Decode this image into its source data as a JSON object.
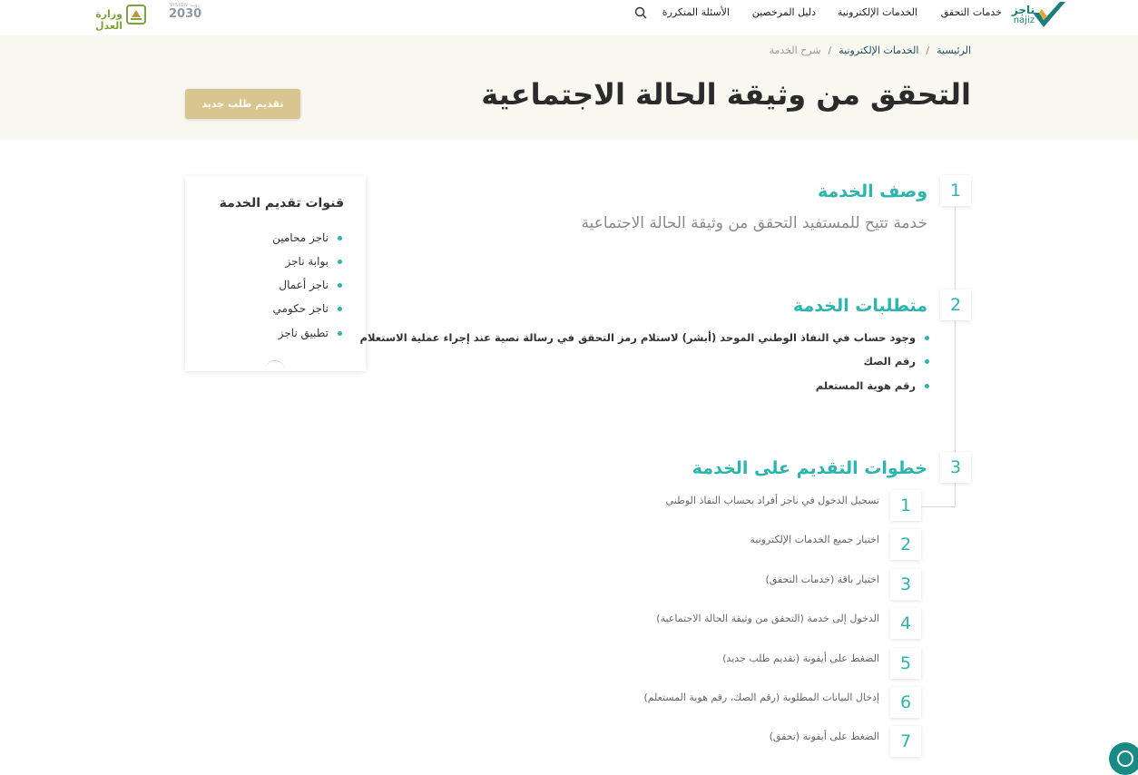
{
  "nav": {
    "brand_ar": "ناجز",
    "brand_en": "najiz",
    "items": [
      "خدمات التحقق",
      "الخدمات الإلكترونية",
      "دليل المرخصين",
      "الأسئلة المتكررة"
    ],
    "vision_top": "VISION رؤيـة",
    "vision_num": "2030",
    "moj": "وزارة العدل"
  },
  "breadcrumb": {
    "home": "الرئيسية",
    "sep": "/",
    "eservices": "الخدمات الإلكترونية",
    "current": "شرح الخدمة"
  },
  "page": {
    "title": "التحقق من وثيقة الحالة الاجتماعية",
    "new_request_button": "تقديم طلب جديد"
  },
  "channels": {
    "title": "قنوات تقديم الخدمة",
    "items": [
      "ناجز محامين",
      "بوابة ناجز",
      "ناجز أعمال",
      "ناجز حكومي",
      "تطبيق ناجز"
    ]
  },
  "sections": [
    {
      "number": "1",
      "title": "وصف الخدمة",
      "description": "خدمة تتيح للمستفيد التحقق من وثيقة الحالة الاجتماعية"
    },
    {
      "number": "2",
      "title": "متطلبات الخدمة",
      "items": [
        "وجود حساب في النفاذ الوطني الموحد (أبشر) لاستلام رمز التحقق في رسالة نصية عند إجراء عملية الاستعلام",
        "رقم الصك",
        "رقم هوية المستعلم"
      ]
    },
    {
      "number": "3",
      "title": "خطوات التقديم على الخدمة",
      "steps": [
        {
          "n": "1",
          "text": "تسجيل الدخول في ناجز أفراد بحساب النفاذ الوطني"
        },
        {
          "n": "2",
          "text": "اختيار جميع الخدمات الإلكترونية"
        },
        {
          "n": "3",
          "text": "اختيار باقة (خدمات التحقق)"
        },
        {
          "n": "4",
          "text": "الدخول إلى خدمة (التحقق من وثيقة الحالة الاجتماعية)"
        },
        {
          "n": "5",
          "text": "الضغط على أيقونة (تقديم طلب جديد)"
        },
        {
          "n": "6",
          "text": "إدخال البيانات المطلوبة (رقم الصك، رقم هوية المستعلم)"
        },
        {
          "n": "7",
          "text": "الضغط على أيقونة (تحقق)"
        }
      ]
    }
  ],
  "colors": {
    "accent": "#2bb5ac",
    "gold_button": "#d8c58f",
    "hero_bg": "#f8f7f0"
  },
  "icons": {
    "search": "search-icon",
    "help": "support-chat-icon"
  }
}
